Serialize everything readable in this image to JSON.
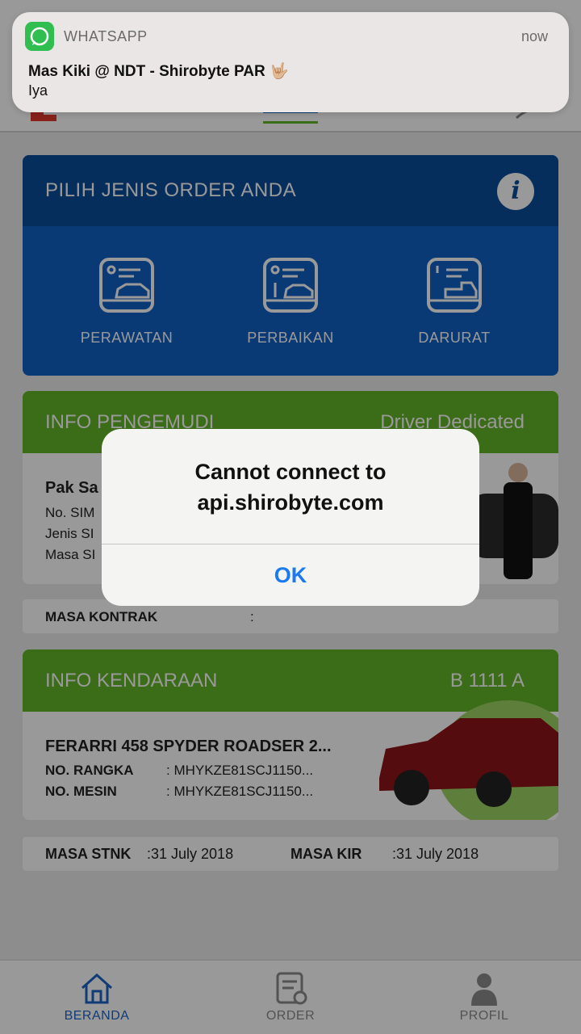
{
  "order": {
    "title": "PILIH JENIS ORDER ANDA",
    "info_icon_glyph": "i",
    "options": [
      {
        "label": "PERAWATAN",
        "icon": "car-checklist-icon"
      },
      {
        "label": "PERBAIKAN",
        "icon": "car-repair-icon"
      },
      {
        "label": "DARURAT",
        "icon": "tow-truck-icon"
      }
    ]
  },
  "driver": {
    "section_title": "INFO PENGEMUDI",
    "type": "Driver Dedicated",
    "name": "Pak Sa",
    "sim": "No. SIM",
    "jenis": "Jenis SI",
    "masa": "Masa SI"
  },
  "contract": {
    "label": "MASA KONTRAK",
    "colon": ":"
  },
  "vehicle": {
    "section_title": "INFO KENDARAAN",
    "plate": "B 1111 A",
    "name": "FERARRI 458 SPYDER ROADSER 2...",
    "rangka_label": "NO. RANGKA",
    "rangka_value": ": MHYKZE81SCJ1150...",
    "mesin_label": "NO. MESIN",
    "mesin_value": ": MHYKZE81SCJ1150..."
  },
  "documents": {
    "stnk_label": "MASA STNK",
    "stnk_value": ":31 July 2018",
    "kir_label": "MASA KIR",
    "kir_value": ":31 July 2018"
  },
  "tabs": [
    {
      "label": "BERANDA",
      "icon": "home-icon",
      "active": true
    },
    {
      "label": "ORDER",
      "icon": "order-icon",
      "active": false
    },
    {
      "label": "PROFIL",
      "icon": "person-icon",
      "active": false
    }
  ],
  "notification": {
    "app": "WHATSAPP",
    "time": "now",
    "title": "Mas Kiki @ NDT - Shirobyte PAR 🤟🏼",
    "body": "Iya"
  },
  "alert": {
    "line1": "Cannot connect to",
    "line2": "api.shirobyte.com",
    "button": "OK"
  },
  "colors": {
    "accent_blue": "#1a7af0",
    "order_blue": "#1162c3",
    "green": "#63b527",
    "tab_active": "#1b63c6"
  }
}
